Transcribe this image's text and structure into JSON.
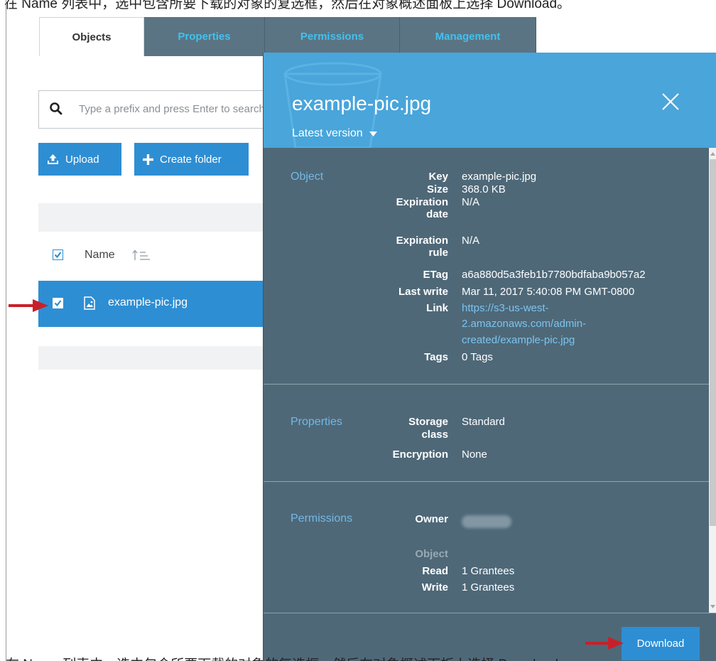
{
  "instruction": "在 Name 列表中，选中包含所要下载的对象的复选框，然后在对象概述面板上选择 Download。",
  "tabs": [
    {
      "label": "Objects"
    },
    {
      "label": "Properties"
    },
    {
      "label": "Permissions"
    },
    {
      "label": "Management"
    }
  ],
  "search": {
    "placeholder": "Type a prefix and press Enter to search"
  },
  "toolbar": {
    "upload_label": "Upload",
    "create_folder_label": "Create folder"
  },
  "list": {
    "name_header": "Name",
    "rows": [
      {
        "name": "example-pic.jpg",
        "checked": true
      }
    ]
  },
  "panel": {
    "title": "example-pic.jpg",
    "version_label": "Latest version",
    "object": {
      "section": "Object",
      "key_label": "Key",
      "key": "example-pic.jpg",
      "size_label": "Size",
      "size": "368.0 KB",
      "exp_date_label_1": "Expiration",
      "exp_date_label_2": "date",
      "exp_date": "N/A",
      "exp_rule_label_1": "Expiration",
      "exp_rule_label_2": "rule",
      "exp_rule": "N/A",
      "etag_label": "ETag",
      "etag": "a6a880d5a3feb1b7780bdfaba9b057a2",
      "last_write_label": "Last write",
      "last_write": "Mar 11, 2017 5:40:08 PM GMT-0800",
      "link_label": "Link",
      "link_1": "https://s3-us-west-",
      "link_2": "2.amazonaws.com/admin-",
      "link_3": "created/example-pic.jpg",
      "tags_label": "Tags",
      "tags": "0 Tags"
    },
    "properties": {
      "section": "Properties",
      "storage_label_1": "Storage",
      "storage_label_2": "class",
      "storage": "Standard",
      "encryption_label": "Encryption",
      "encryption": "None"
    },
    "permissions": {
      "section": "Permissions",
      "owner_label": "Owner",
      "object_label": "Object",
      "read_label": "Read",
      "read": "1 Grantees",
      "write_label": "Write",
      "write": "1 Grantees"
    },
    "download_label": "Download"
  },
  "colors": {
    "panel_bg": "#4e6878",
    "panel_header": "#49a5da",
    "tab_inactive": "#5b7483",
    "tab_text_inactive": "#41c1f0",
    "accent_blue": "#2e8ed3",
    "arrow_red": "#c8202a"
  }
}
